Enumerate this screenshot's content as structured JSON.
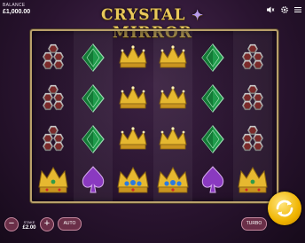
{
  "header": {
    "balance_label": "BALANCE",
    "balance_value": "£1,000.00",
    "title_left": "CRYSTAL",
    "title_right": "MIRROR",
    "icons": [
      "sound-off-icon",
      "settings-icon",
      "menu-icon"
    ]
  },
  "reels": [
    [
      "hexagon-cluster",
      "hexagon-cluster",
      "hexagon-cluster",
      "gold-crown-jeweled"
    ],
    [
      "green-diamond",
      "green-diamond",
      "green-diamond",
      "purple-spade"
    ],
    [
      "gold-crown",
      "gold-crown",
      "gold-crown",
      "blue-jewel-crown"
    ],
    [
      "gold-crown",
      "gold-crown",
      "gold-crown",
      "blue-jewel-crown"
    ],
    [
      "green-diamond",
      "green-diamond",
      "green-diamond",
      "purple-spade"
    ],
    [
      "hexagon-cluster",
      "hexagon-cluster",
      "hexagon-cluster",
      "gold-crown-jeweled"
    ]
  ],
  "controls": {
    "minus_label": "−",
    "plus_label": "+",
    "stake_label": "STAKE",
    "stake_value": "£2.00",
    "auto_label": "AUTO",
    "turbo_label": "TURBO"
  },
  "colors": {
    "accent_gold": "#e9c85a",
    "button_bg": "#6a2f48",
    "spin_button": "#f0b400"
  }
}
